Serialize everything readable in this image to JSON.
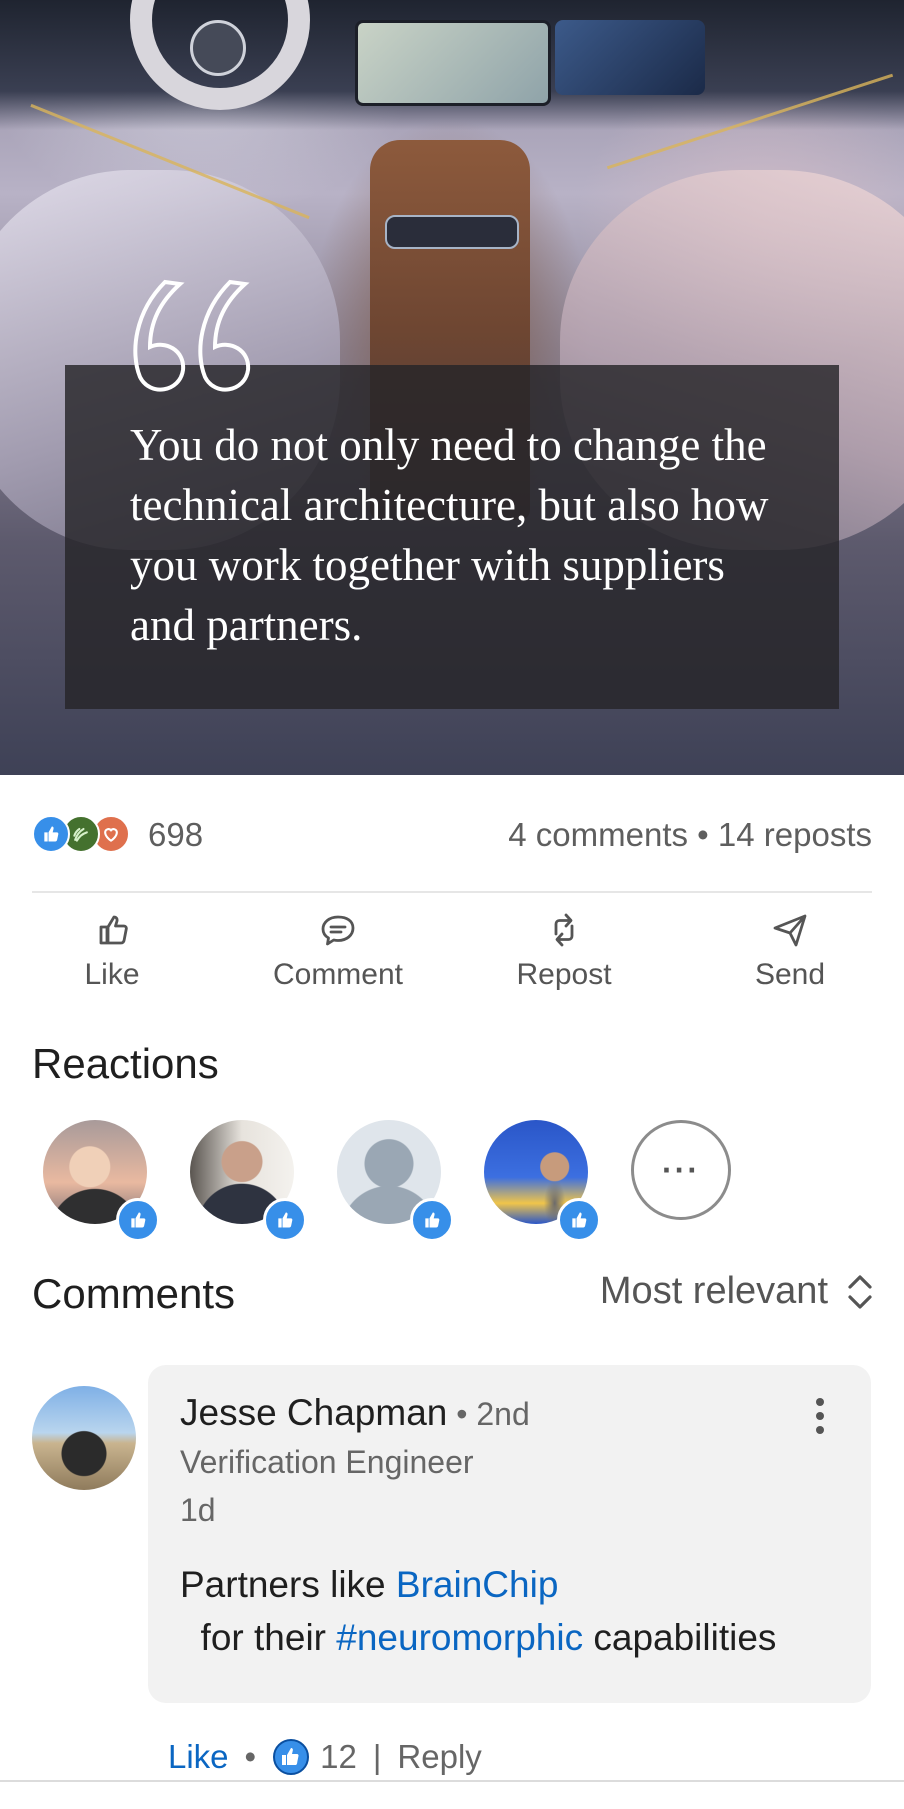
{
  "hero": {
    "quote_text": "You do not only need to change the technical architecture, but also how you work together with suppliers and partners."
  },
  "social": {
    "reaction_icons": [
      "like-icon",
      "celebrate-icon",
      "love-icon"
    ],
    "reaction_count": "698",
    "comments_reposts": "4 comments • 14 reposts"
  },
  "actions": {
    "like": "Like",
    "comment": "Comment",
    "repost": "Repost",
    "send": "Send"
  },
  "reactions": {
    "title": "Reactions",
    "more": "···"
  },
  "comments": {
    "title": "Comments",
    "sort_label": "Most relevant",
    "items": [
      {
        "name": "Jesse Chapman",
        "degree": " • 2nd",
        "headline": "Verification Engineer",
        "time": "1d",
        "text_before": "Partners like ",
        "mention": "BrainChip",
        "text_middle": "  for their ",
        "hashtag": "#neuromorphic",
        "text_after": " capabilities",
        "like_label": "Like",
        "like_count": "12",
        "reply_label": "Reply"
      }
    ]
  },
  "colors": {
    "accent": "#0a66c2",
    "like_blue": "#378fe9",
    "love_red": "#df704d",
    "celebrate_green": "#44712e"
  }
}
